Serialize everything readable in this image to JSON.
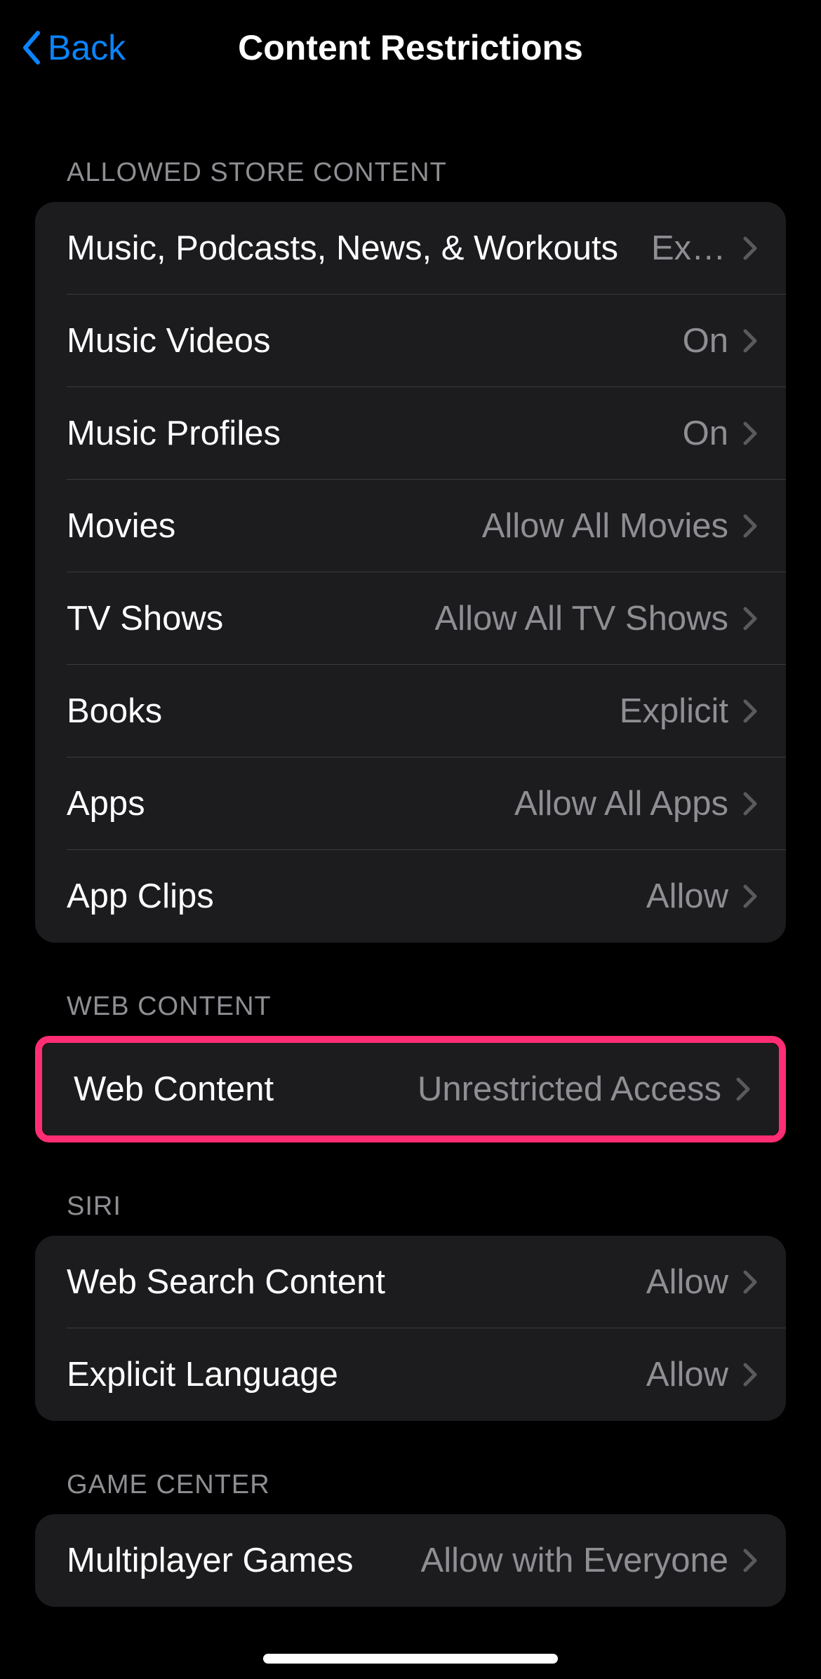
{
  "nav": {
    "back_label": "Back",
    "title": "Content Restrictions"
  },
  "sections": {
    "store": {
      "header": "ALLOWED STORE CONTENT",
      "items": [
        {
          "label": "Music, Podcasts, News, & Workouts",
          "value": "Explicit"
        },
        {
          "label": "Music Videos",
          "value": "On"
        },
        {
          "label": "Music Profiles",
          "value": "On"
        },
        {
          "label": "Movies",
          "value": "Allow All Movies"
        },
        {
          "label": "TV Shows",
          "value": "Allow All TV Shows"
        },
        {
          "label": "Books",
          "value": "Explicit"
        },
        {
          "label": "Apps",
          "value": "Allow All Apps"
        },
        {
          "label": "App Clips",
          "value": "Allow"
        }
      ]
    },
    "web": {
      "header": "WEB CONTENT",
      "items": [
        {
          "label": "Web Content",
          "value": "Unrestricted Access"
        }
      ]
    },
    "siri": {
      "header": "SIRI",
      "items": [
        {
          "label": "Web Search Content",
          "value": "Allow"
        },
        {
          "label": "Explicit Language",
          "value": "Allow"
        }
      ]
    },
    "gamecenter": {
      "header": "GAME CENTER",
      "items": [
        {
          "label": "Multiplayer Games",
          "value": "Allow with Everyone"
        }
      ]
    }
  },
  "colors": {
    "accent": "#0a84ff",
    "highlight": "#ff2d73",
    "background": "#000000",
    "group_bg": "#1c1c1e",
    "secondary_text": "#8e8e93"
  }
}
